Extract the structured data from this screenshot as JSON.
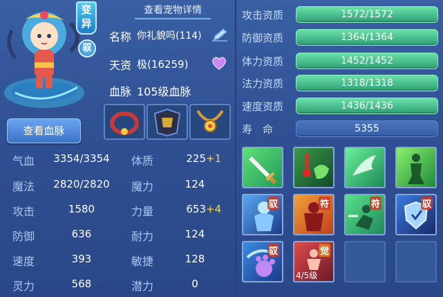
{
  "pet": {
    "badge_mutant": "变异",
    "badge_yu": "驭",
    "view_detail": "查看宠物详情",
    "name_label": "名称",
    "name_value": "你礼貌吗(114)",
    "aptitude_label": "天资",
    "aptitude_value": "极(16259)",
    "bloodline_label": "血脉",
    "bloodline_value": "105级血脉",
    "view_bloodline": "查看血脉"
  },
  "stats": {
    "hp_label": "气血",
    "hp_value": "3354/3354",
    "mp_label": "魔法",
    "mp_value": "2820/2820",
    "attack_label": "攻击",
    "attack_value": "1580",
    "defense_label": "防御",
    "defense_value": "636",
    "speed_label": "速度",
    "speed_value": "393",
    "spirit_label": "灵力",
    "spirit_value": "568",
    "constitution_label": "体质",
    "constitution_value": "225",
    "constitution_plus": "+1",
    "magic_label": "魔力",
    "magic_value": "124",
    "strength_label": "力量",
    "strength_value": "653",
    "strength_plus": "+4",
    "endurance_label": "耐力",
    "endurance_value": "124",
    "agility_label": "敏捷",
    "agility_value": "128",
    "potential_label": "潜力",
    "potential_value": "0"
  },
  "aptitudes": [
    {
      "label": "攻击资质",
      "value": "1572/1572"
    },
    {
      "label": "防御资质",
      "value": "1364/1364"
    },
    {
      "label": "体力资质",
      "value": "1452/1452"
    },
    {
      "label": "法力资质",
      "value": "1318/1318"
    },
    {
      "label": "速度资质",
      "value": "1436/1436"
    }
  ],
  "lifespan": {
    "label": "寿　命",
    "value": "5355"
  },
  "skills": {
    "tag_fu": "符",
    "tag_yu": "驭",
    "tag_jue": "觉",
    "level_text": "4/5级"
  },
  "colors": {
    "bar_green": "#3fb884",
    "stat_plus": "#ffd541",
    "panel_bg": "#2e4f92"
  }
}
